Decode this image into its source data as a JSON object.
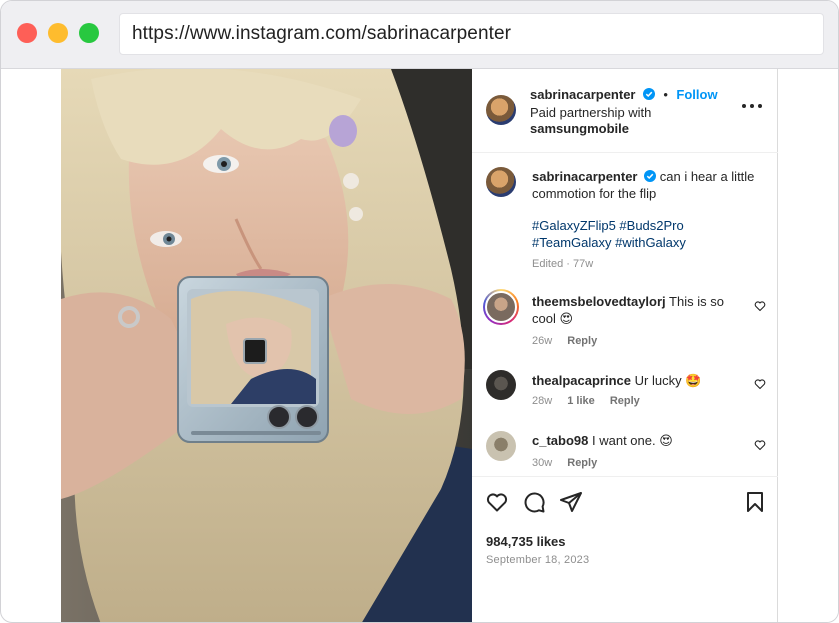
{
  "browser": {
    "url": "https://www.instagram.com/sabrinacarpenter"
  },
  "post": {
    "author": "sabrinacarpenter",
    "follow_label": "Follow",
    "separator": "•",
    "partnership_text": "Paid partnership with",
    "partner": "samsungmobile",
    "caption_text": "can i hear a little commotion for the flip",
    "hashtags_line1": "#GalaxyZFlip5 #Buds2Pro",
    "hashtags_line2": "#TeamGalaxy #withGalaxy",
    "caption_meta": "Edited · 77w",
    "likes": "984,735 likes",
    "date": "September 18, 2023"
  },
  "comments": [
    {
      "user": "theemsbelovedtaylorj",
      "text": "This is so cool 😍",
      "age": "26w",
      "likes": "",
      "reply": "Reply"
    },
    {
      "user": "thealpacaprince",
      "text": "Ur lucky 🤩",
      "age": "28w",
      "likes": "1 like",
      "reply": "Reply"
    },
    {
      "user": "c_tabo98",
      "text": "I want one. 😍",
      "age": "30w",
      "likes": "",
      "reply": "Reply"
    }
  ],
  "icons": {
    "like": "heart-icon",
    "comment": "comment-icon",
    "share": "share-icon",
    "save": "bookmark-icon",
    "more": "more-options-icon",
    "verified": "verified-badge-icon"
  },
  "colors": {
    "follow": "#0095f6",
    "hashtag": "#00376b",
    "verified": "#0095f6"
  }
}
